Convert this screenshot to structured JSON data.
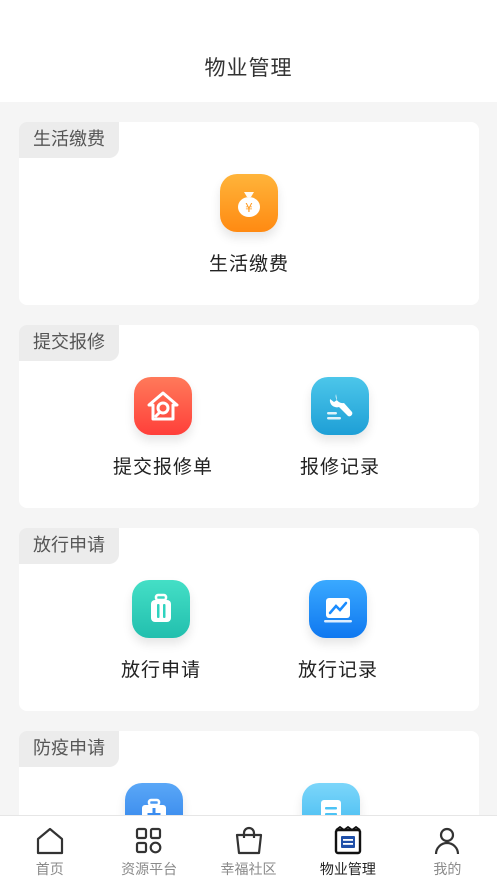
{
  "header": {
    "title": "物业管理"
  },
  "sections": [
    {
      "tag": "生活缴费",
      "items": [
        {
          "label": "生活缴费",
          "icon": "money-bag-icon",
          "color": "#ff9a1f"
        }
      ]
    },
    {
      "tag": "提交报修",
      "items": [
        {
          "label": "提交报修单",
          "icon": "house-wrench-icon",
          "color": "#ff5e4d"
        },
        {
          "label": "报修记录",
          "icon": "wrench-list-icon",
          "color": "#2eaee0"
        }
      ]
    },
    {
      "tag": "放行申请",
      "items": [
        {
          "label": "放行申请",
          "icon": "luggage-icon",
          "color": "#2fd3bf"
        },
        {
          "label": "放行记录",
          "icon": "release-record-icon",
          "color": "#1a8cff"
        }
      ]
    },
    {
      "tag": "防疫申请",
      "items": [
        {
          "label": "",
          "icon": "medical-kit-icon",
          "color": "#3a8cf0"
        },
        {
          "label": "",
          "icon": "notepad-icon",
          "color": "#4cc3f5"
        }
      ]
    }
  ],
  "tabbar": {
    "tabs": [
      {
        "label": "首页",
        "icon": "home-icon",
        "active": false
      },
      {
        "label": "资源平台",
        "icon": "grid-apps-icon",
        "active": false
      },
      {
        "label": "幸福社区",
        "icon": "shopping-bag-icon",
        "active": false
      },
      {
        "label": "物业管理",
        "icon": "property-doc-icon",
        "active": true
      },
      {
        "label": "我的",
        "icon": "person-icon",
        "active": false
      }
    ]
  }
}
